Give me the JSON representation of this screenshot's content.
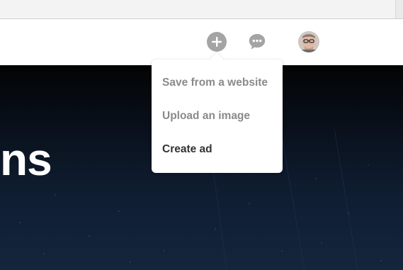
{
  "header": {
    "add_icon": "plus-circle-icon",
    "messages_icon": "speech-bubble-icon",
    "avatar_alt": "user-avatar"
  },
  "hero": {
    "title_fragment": "ns"
  },
  "add_menu": {
    "items": [
      {
        "label": "Save from a website",
        "state": "muted"
      },
      {
        "label": "Upload an image",
        "state": "muted"
      },
      {
        "label": "Create ad",
        "state": "active"
      }
    ]
  },
  "colors": {
    "icon_gray": "#a4a4a4",
    "menu_muted_text": "#8a8a8a",
    "menu_active_text": "#333333",
    "hero_dark": "#030405",
    "hero_blue": "#14253d"
  }
}
